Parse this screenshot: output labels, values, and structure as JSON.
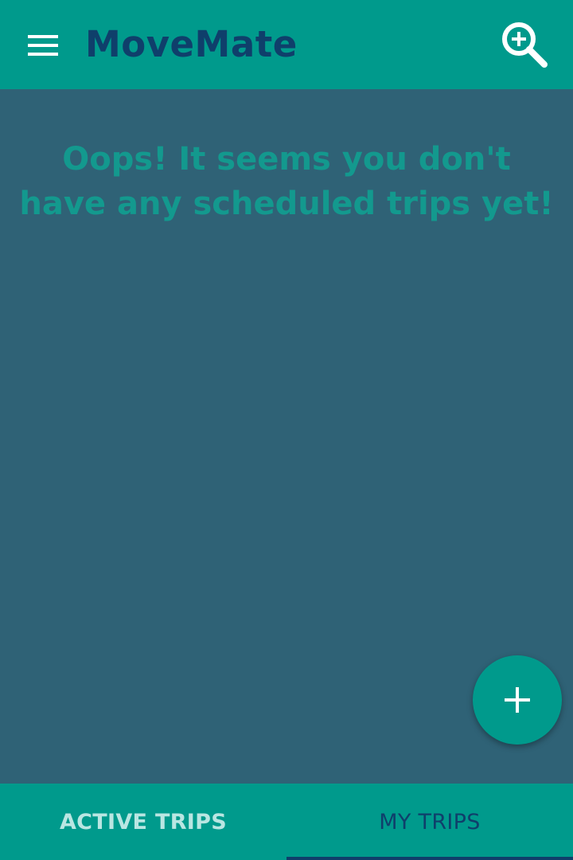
{
  "app_bar": {
    "title": "MoveMate",
    "menu_icon": "menu-icon",
    "search_icon": "zoom-in-icon",
    "background": "#009a8c",
    "title_color": "#0f3f6b"
  },
  "main": {
    "empty_message": "Oops! It seems you don't have any scheduled trips yet!",
    "background": "#2f6276",
    "message_color": "#13998e"
  },
  "fab": {
    "icon": "plus-icon",
    "background": "#009a8c"
  },
  "tabs": [
    {
      "label": "ACTIVE TRIPS",
      "selected": false
    },
    {
      "label": "MY TRIPS",
      "selected": true
    }
  ],
  "tab_indicator_color": "#0f3f6b"
}
